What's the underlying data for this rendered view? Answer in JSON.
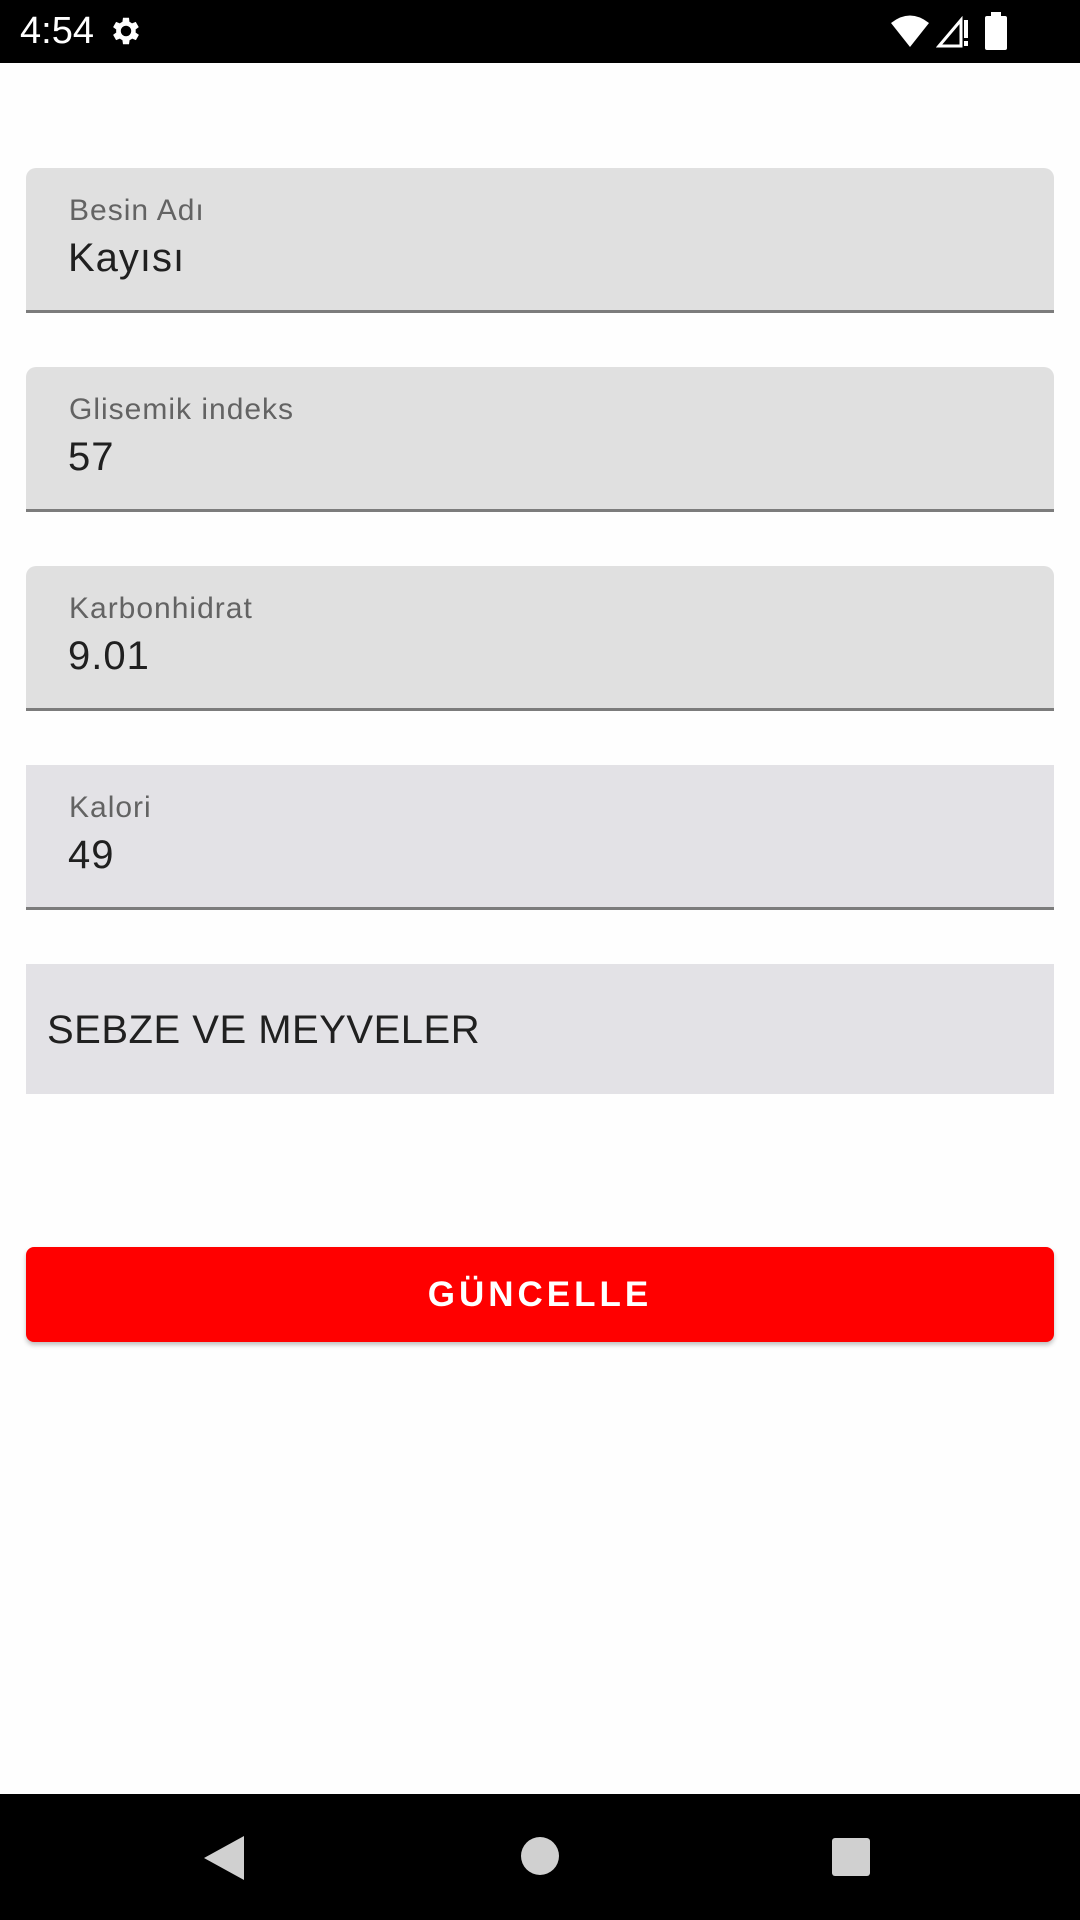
{
  "status_bar": {
    "time": "4:54",
    "icons": [
      "gear-icon",
      "wifi-icon",
      "signal-icon",
      "battery-icon"
    ]
  },
  "form": {
    "fields": [
      {
        "label": "Besin Adı",
        "value": "Kayısı",
        "background": "#e0e0e0"
      },
      {
        "label": "Glisemik indeks",
        "value": "57",
        "background": "#e0e0e0"
      },
      {
        "label": "Karbonhidrat",
        "value": "9.01",
        "background": "#e0e0e0"
      },
      {
        "label": "Kalori",
        "value": "49",
        "background": "#e3e2e6"
      }
    ],
    "category": "SEBZE VE MEYVELER",
    "update_label": "GÜNCELLE"
  },
  "colors": {
    "accent": "#ff0000",
    "field_background": "#e0e0e0",
    "focused_field_background": "#e3e2e6",
    "underline": "#7c7c7c"
  },
  "nav_bar": {
    "icons": [
      "back-icon",
      "home-icon",
      "recents-icon"
    ]
  }
}
